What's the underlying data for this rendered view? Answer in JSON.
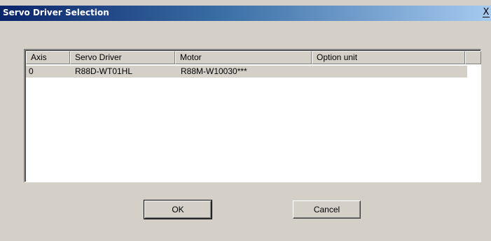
{
  "window": {
    "title": "Servo Driver Selection",
    "close_glyph": "X"
  },
  "table": {
    "columns": [
      "Axis",
      "Servo Driver",
      "Motor",
      "Option unit",
      ""
    ],
    "rows": [
      {
        "axis": "0",
        "servo_driver": "R88D-WT01HL",
        "motor": "R88M-W10030***",
        "option_unit": ""
      }
    ],
    "selected_row_color": "#d4d0c8"
  },
  "buttons": {
    "ok_label": "OK",
    "cancel_label": "Cancel"
  },
  "colors": {
    "title_start": "#0a246a",
    "title_end": "#a6caf0",
    "face": "#d4d0c8"
  }
}
